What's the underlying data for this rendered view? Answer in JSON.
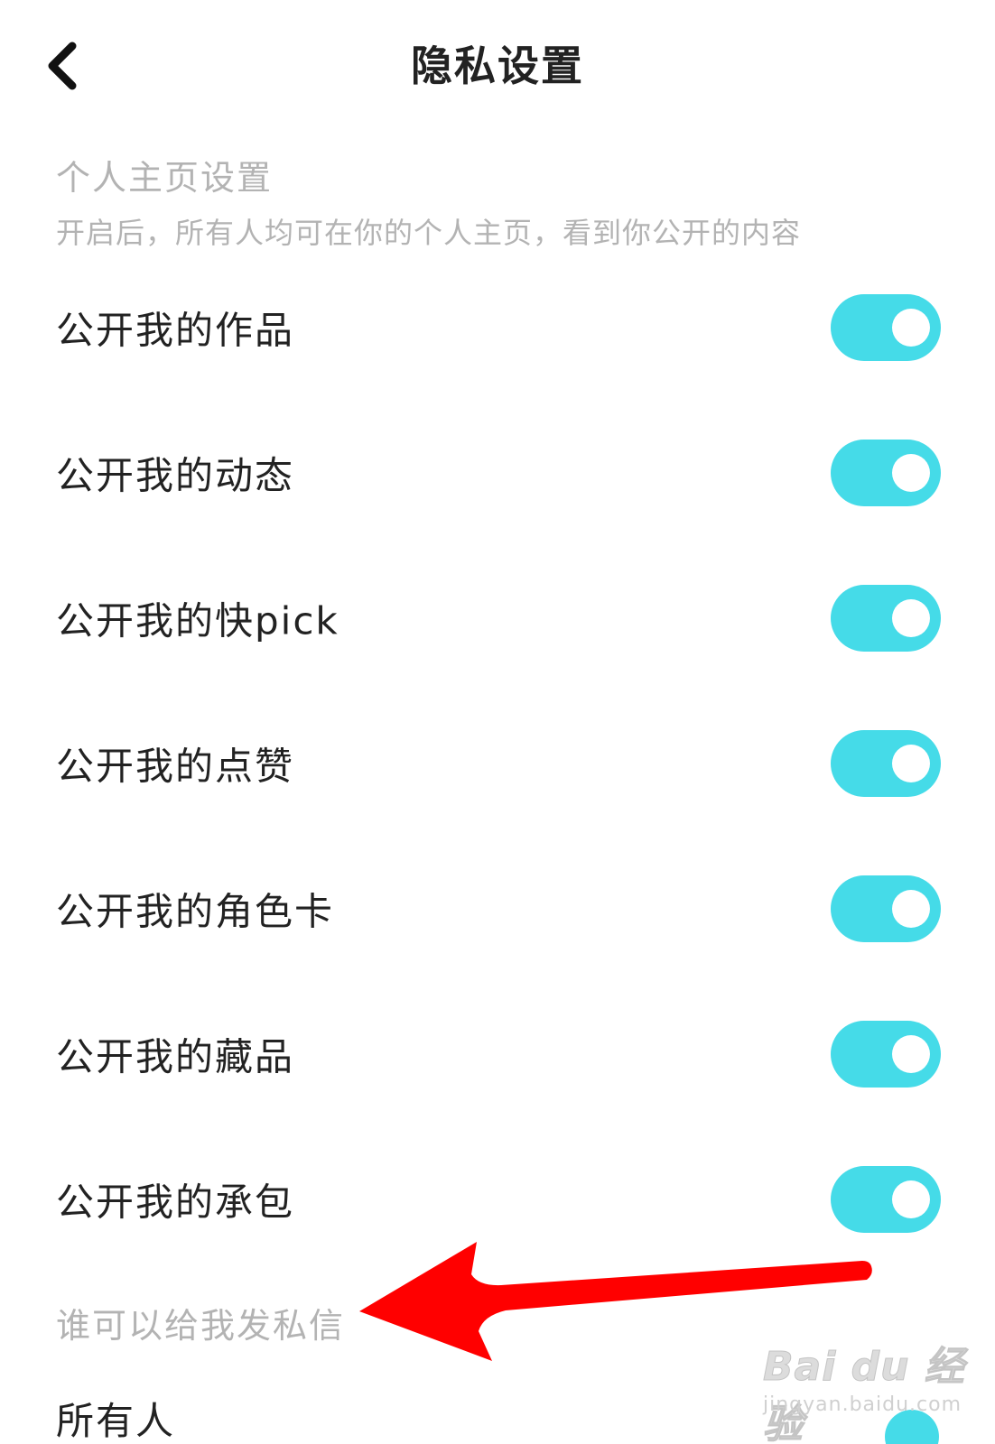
{
  "header": {
    "title": "隐私设置",
    "back_icon": "chevron-left-icon"
  },
  "profile_section": {
    "title": "个人主页设置",
    "description": "开启后，所有人均可在你的个人主页，看到你公开的内容",
    "items": [
      {
        "label": "公开我的作品",
        "enabled": true
      },
      {
        "label": "公开我的动态",
        "enabled": true
      },
      {
        "label": "公开我的快pick",
        "enabled": true
      },
      {
        "label": "公开我的点赞",
        "enabled": true
      },
      {
        "label": "公开我的角色卡",
        "enabled": true
      },
      {
        "label": "公开我的藏品",
        "enabled": true
      },
      {
        "label": "公开我的承包",
        "enabled": true
      }
    ]
  },
  "message_section": {
    "title": "谁可以给我发私信",
    "first_option": "所有人"
  },
  "colors": {
    "toggle_on": "#45dbe8",
    "annotation_arrow": "#ff0000",
    "section_text": "#b3b3b3",
    "primary_text": "#222222"
  },
  "watermark": {
    "logo": "Bai du 经验",
    "url": "jingyan.baidu.com"
  }
}
